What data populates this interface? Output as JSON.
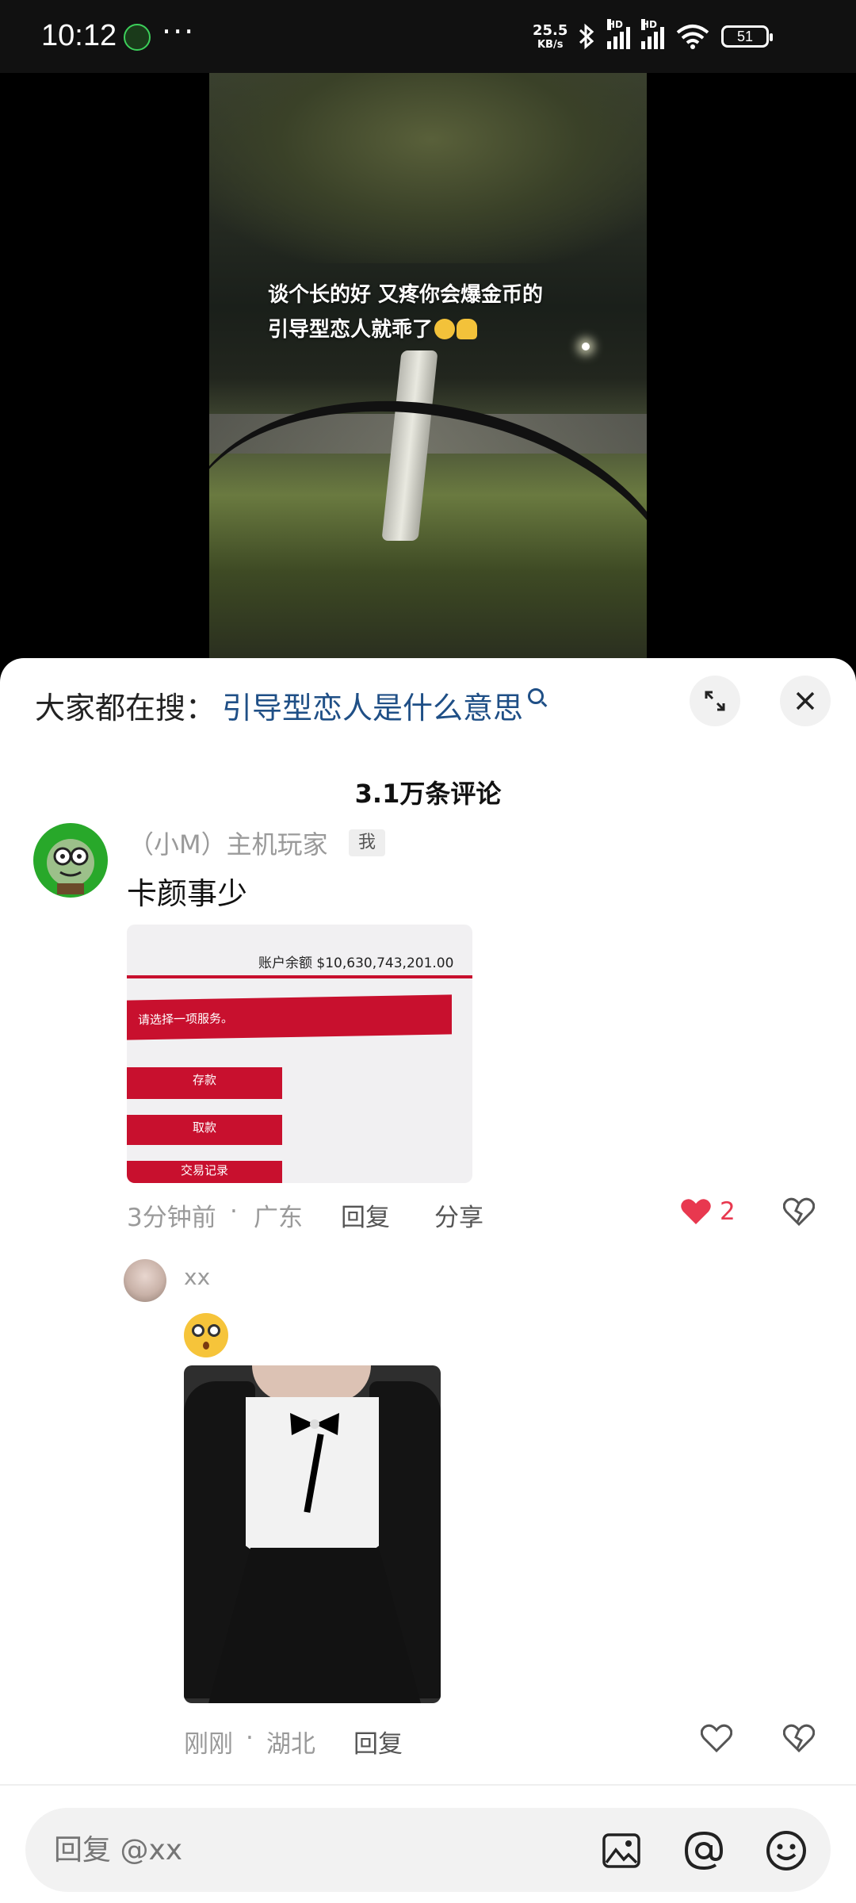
{
  "status_bar": {
    "time": "10:12",
    "more": "···",
    "net_speed_value": "25.5",
    "net_speed_unit": "KB/s",
    "signal1_label": "HD",
    "signal2_label": "HD",
    "battery": "51"
  },
  "video": {
    "caption_line1": "谈个长的好 又疼你会爆金币的",
    "caption_line2": "引导型恋人就乖了"
  },
  "sheet": {
    "search_prefix": "大家都在搜：",
    "search_query": "引导型恋人是什么意思",
    "comment_count": "3.1万条评论"
  },
  "comments": [
    {
      "username": "（小M）主机玩家",
      "badge": "我",
      "text": "卡颜事少",
      "image": {
        "balance_label": "账户余额  $10,630,743,201.00",
        "service_prompt": "请选择一项服务。",
        "buttons": [
          "存款",
          "取款",
          "交易记录"
        ]
      },
      "time": "3分钟前",
      "location": "广东",
      "reply_label": "回复",
      "share_label": "分享",
      "likes": "2",
      "liked": true
    },
    {
      "username": "xx",
      "time": "刚刚",
      "location": "湖北",
      "reply_label": "回复"
    }
  ],
  "reply_bar": {
    "placeholder": "回复 @xx"
  },
  "colors": {
    "accent_link": "#1f4f86",
    "like_red": "#e8384f",
    "bank_red": "#c8102e"
  }
}
